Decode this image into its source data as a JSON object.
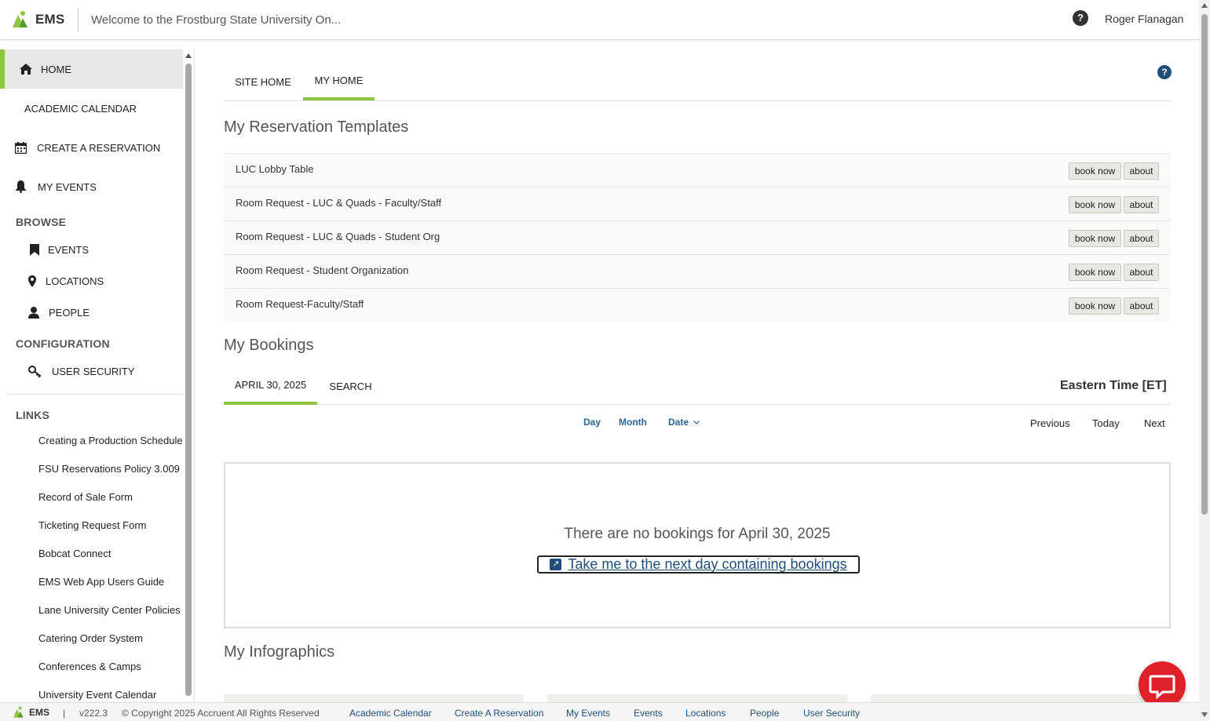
{
  "header": {
    "logo_text": "EMS",
    "title": "Welcome to the Frostburg State University On...",
    "help_symbol": "?",
    "user_name": "Roger Flanagan"
  },
  "sidebar": {
    "home": "HOME",
    "academic_calendar": "ACADEMIC CALENDAR",
    "create_reservation": "CREATE A RESERVATION",
    "my_events": "MY EVENTS",
    "browse_heading": "BROWSE",
    "browse_items": [
      "EVENTS",
      "LOCATIONS",
      "PEOPLE"
    ],
    "configuration_heading": "CONFIGURATION",
    "user_security": "USER SECURITY",
    "links_heading": "LINKS",
    "links": [
      "Creating a Production Schedule",
      "FSU Reservations Policy 3.009",
      "Record of Sale Form",
      "Ticketing Request Form",
      "Bobcat Connect",
      "EMS Web App Users Guide",
      "Lane University Center Policies",
      "Catering Order System",
      "Conferences & Camps",
      "University Event Calendar"
    ]
  },
  "main": {
    "tabs": [
      "SITE HOME",
      "MY HOME"
    ],
    "help_symbol": "?",
    "templates_title": "My Reservation Templates",
    "templates": [
      "LUC Lobby Table",
      "Room Request - LUC & Quads - Faculty/Staff",
      "Room Request - LUC & Quads - Student Org",
      "Room Request - Student Organization",
      "Room Request-Faculty/Staff"
    ],
    "book_now_label": "book now",
    "about_label": "about",
    "bookings_title": "My Bookings",
    "bookings_tabs": [
      "APRIL 30, 2025",
      "SEARCH"
    ],
    "timezone": "Eastern Time [ET]",
    "view_day": "Day",
    "view_month": "Month",
    "view_date": "Date",
    "nav_previous": "Previous",
    "nav_today": "Today",
    "nav_next": "Next",
    "empty_message": "There are no bookings for April 30, 2025",
    "next_day_link": "Take me to the next day containing bookings",
    "infographics_title": "My Infographics"
  },
  "footer": {
    "logo_text": "EMS",
    "version": "v222.3",
    "copyright": "© Copyright 2025 Accruent All Rights Reserved",
    "links": [
      "Academic Calendar",
      "Create A Reservation",
      "My Events",
      "Events",
      "Locations",
      "People",
      "User Security"
    ]
  },
  "colors": {
    "accent_green": "#8dc63f",
    "link_blue": "#1f4e79",
    "chat_red": "#e0212b"
  }
}
